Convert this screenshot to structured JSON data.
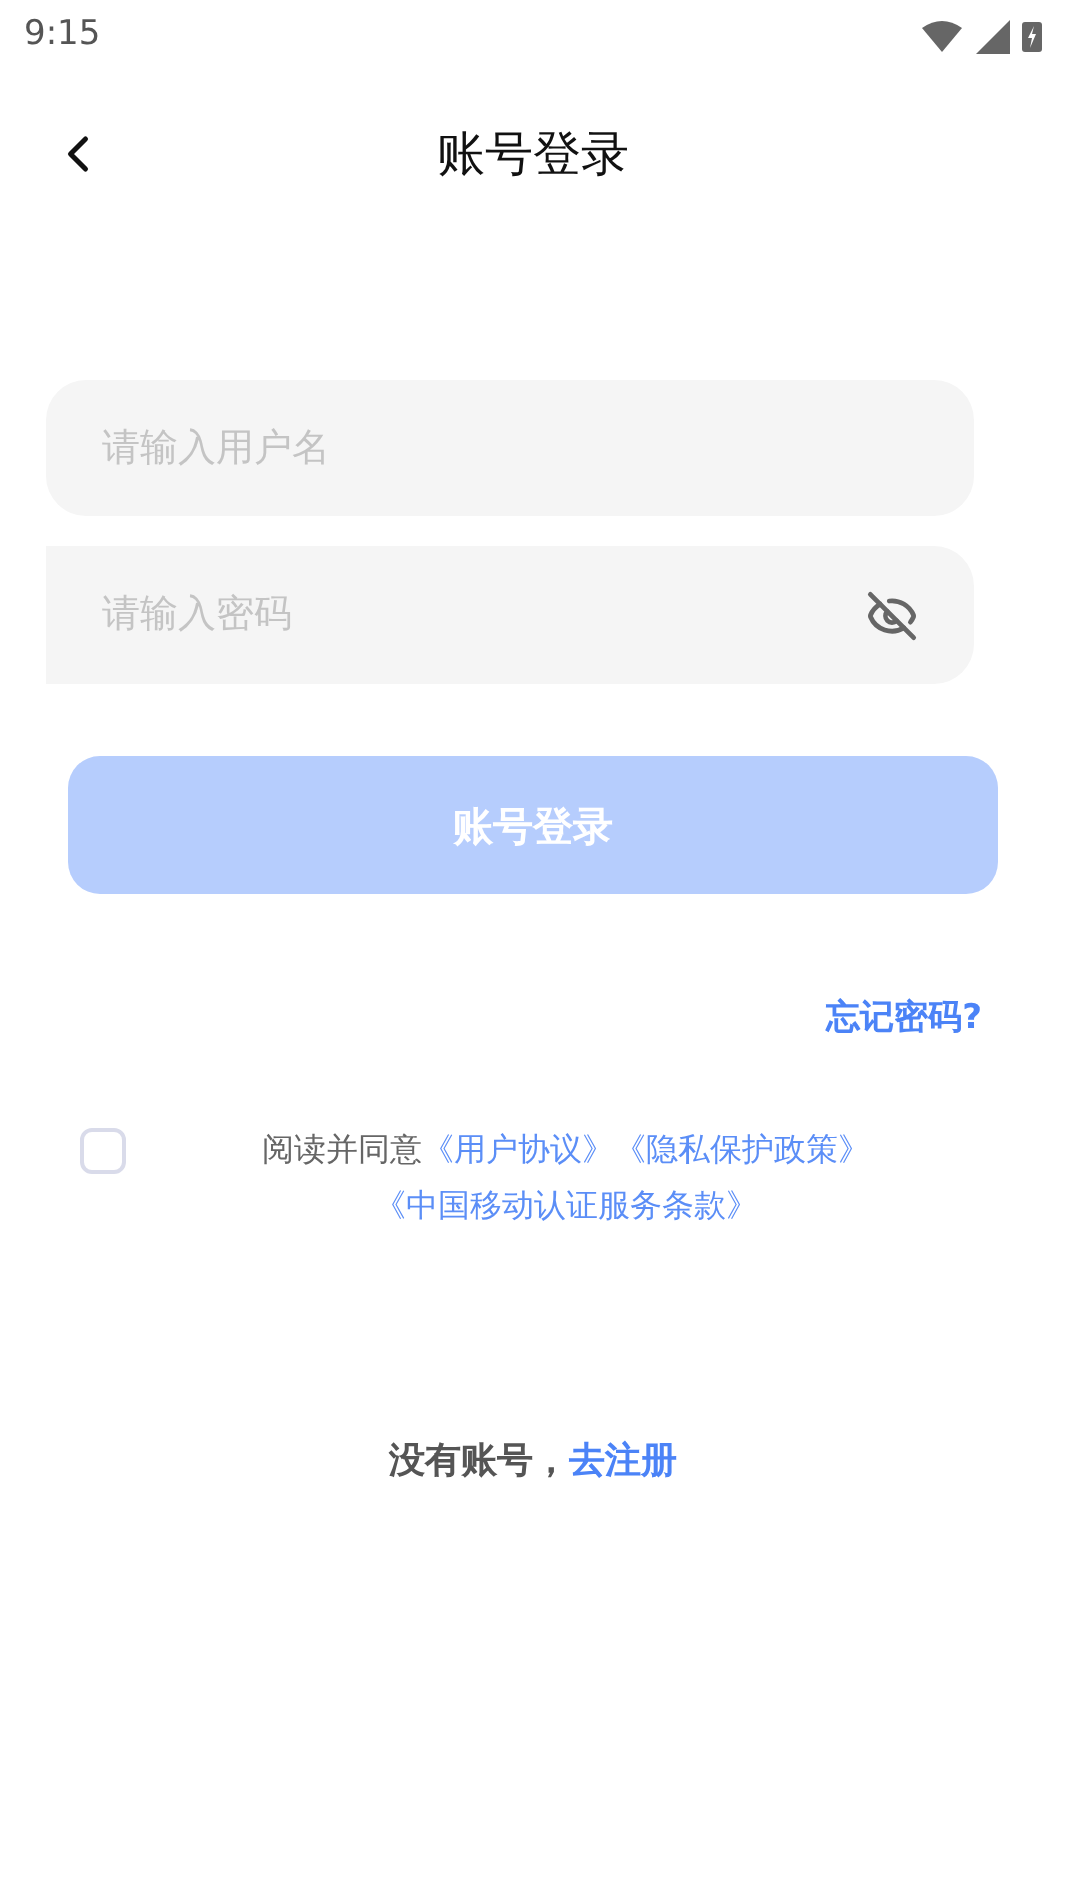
{
  "status_bar": {
    "time": "9:15"
  },
  "header": {
    "title": "账号登录"
  },
  "username_field": {
    "placeholder": "请输入用户名"
  },
  "password_field": {
    "placeholder": "请输入密码"
  },
  "login_button": {
    "label": "账号登录",
    "disabled": true
  },
  "forgot_link": "忘记密码?",
  "agreement": {
    "checked": false,
    "text": "阅读并同意",
    "links": [
      "《用户协议》",
      "《隐私保护政策》",
      "《中国移动认证服务条款》"
    ]
  },
  "register": {
    "prompt": "没有账号，",
    "link": "去注册"
  }
}
